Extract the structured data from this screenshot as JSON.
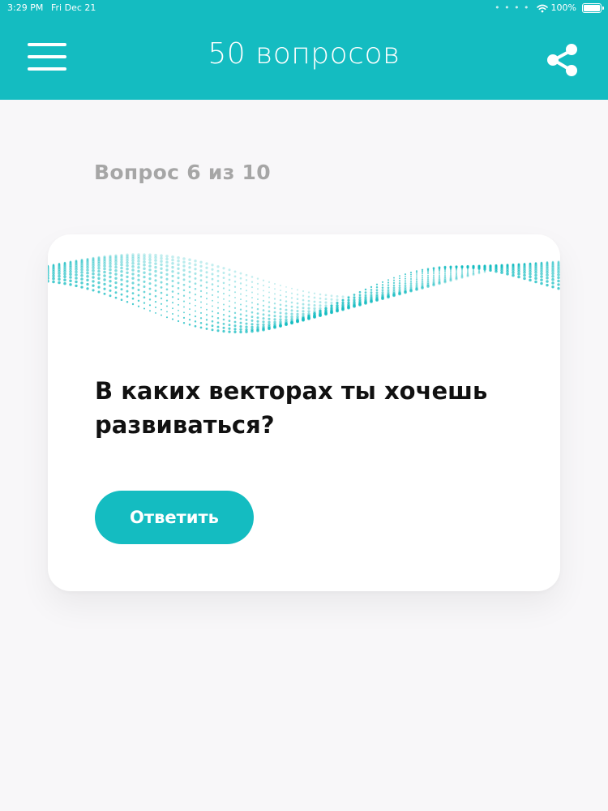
{
  "status_bar": {
    "time": "3:29 PM",
    "date": "Fri Dec 21",
    "battery": "100%",
    "icons": [
      "wifi-icon",
      "battery-icon"
    ]
  },
  "header": {
    "title": "50 вопросов",
    "menu_icon": "hamburger-menu-icon",
    "share_icon": "share-icon"
  },
  "progress": {
    "label": "Вопрос 6 из 10",
    "current": 6,
    "total": 10
  },
  "card": {
    "question": "В каких векторах ты хочешь развиваться?",
    "answer_label": "Ответить",
    "decoration": "wave-dots-pattern"
  },
  "colors": {
    "accent": "#14bcc1",
    "background": "#f8f7f9",
    "card": "#ffffff",
    "counter_text": "#a6a6a6",
    "question_text": "#111111"
  }
}
